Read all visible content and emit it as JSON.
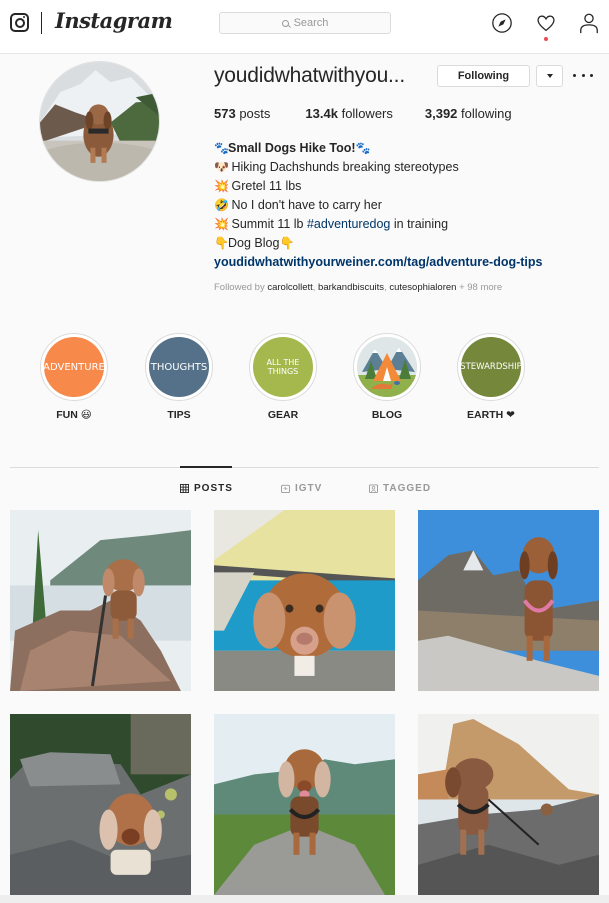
{
  "nav": {
    "wordmark": "Instagram",
    "search_placeholder": "Search",
    "icons": [
      "instagram-glyph-icon",
      "explore-compass-icon",
      "activity-heart-icon",
      "profile-person-icon"
    ],
    "notification_dot_color": "#ed4956"
  },
  "profile": {
    "username": "youdidwhatwithyou...",
    "following_button": "Following",
    "stats": {
      "posts_value": "573",
      "posts_label": "posts",
      "followers_value": "13.4k",
      "followers_label": "followers",
      "following_value": "3,392",
      "following_label": "following"
    },
    "bio": {
      "name": "Small Dogs Hike Too!",
      "name_emoji": "🐾",
      "lines": [
        {
          "emoji": "🐶",
          "text": "Hiking Dachshunds breaking stereotypes"
        },
        {
          "emoji": "💥",
          "text": "Gretel 11 lbs"
        },
        {
          "emoji": "🤣",
          "text": "No I don't have to carry her"
        }
      ],
      "summit_emoji": "💥",
      "summit_pre": "Summit 11 lb ",
      "summit_hashtag": "#adventuredog",
      "summit_post": " in training",
      "blog_emoji": "👇",
      "blog_text": "Dog Blog",
      "link": "youdidwhatwithyourweiner.com/tag/adventure-dog-tips"
    },
    "followed_by": {
      "prefix": "Followed by ",
      "users": [
        "carolcollett",
        "barkandbiscuits",
        "cutesophialoren"
      ],
      "more": "+ 98 more"
    }
  },
  "highlights": [
    {
      "cover_text": "ADVENTURE",
      "label": "FUN 😃",
      "color": "#f7894a"
    },
    {
      "cover_text": "THOUGHTS",
      "label": "TIPS",
      "color": "#557189"
    },
    {
      "cover_text": "ALL THE THINGS",
      "label": "GEAR",
      "color": "#a5b84e"
    },
    {
      "cover_text": "",
      "label": "BLOG",
      "color": "#e8e6d8"
    },
    {
      "cover_text": "STEWARDSHIP",
      "label": "EARTH ❤",
      "color": "#74873a"
    }
  ],
  "tabs": [
    {
      "label": "POSTS",
      "icon": "grid-icon",
      "active": true
    },
    {
      "label": "IGTV",
      "icon": "igtv-icon",
      "active": false
    },
    {
      "label": "TAGGED",
      "icon": "tagged-person-icon",
      "active": false
    }
  ],
  "posts": [
    {
      "description": "Dachshund standing on a rock by a misty lake with pine tree"
    },
    {
      "description": "Dachshund peeking out of a tent onto a blue sleeping bag"
    },
    {
      "description": "Dachshund in pink harness on a granite boulder with mountains and blue sky"
    },
    {
      "description": "Dachshund in a camo vest among lichen-covered rocks in a forest"
    },
    {
      "description": "Dachshund on a boulder with green mountains behind"
    },
    {
      "description": "Dachshund on rocks by a river with a tall sandstone cliff"
    }
  ]
}
